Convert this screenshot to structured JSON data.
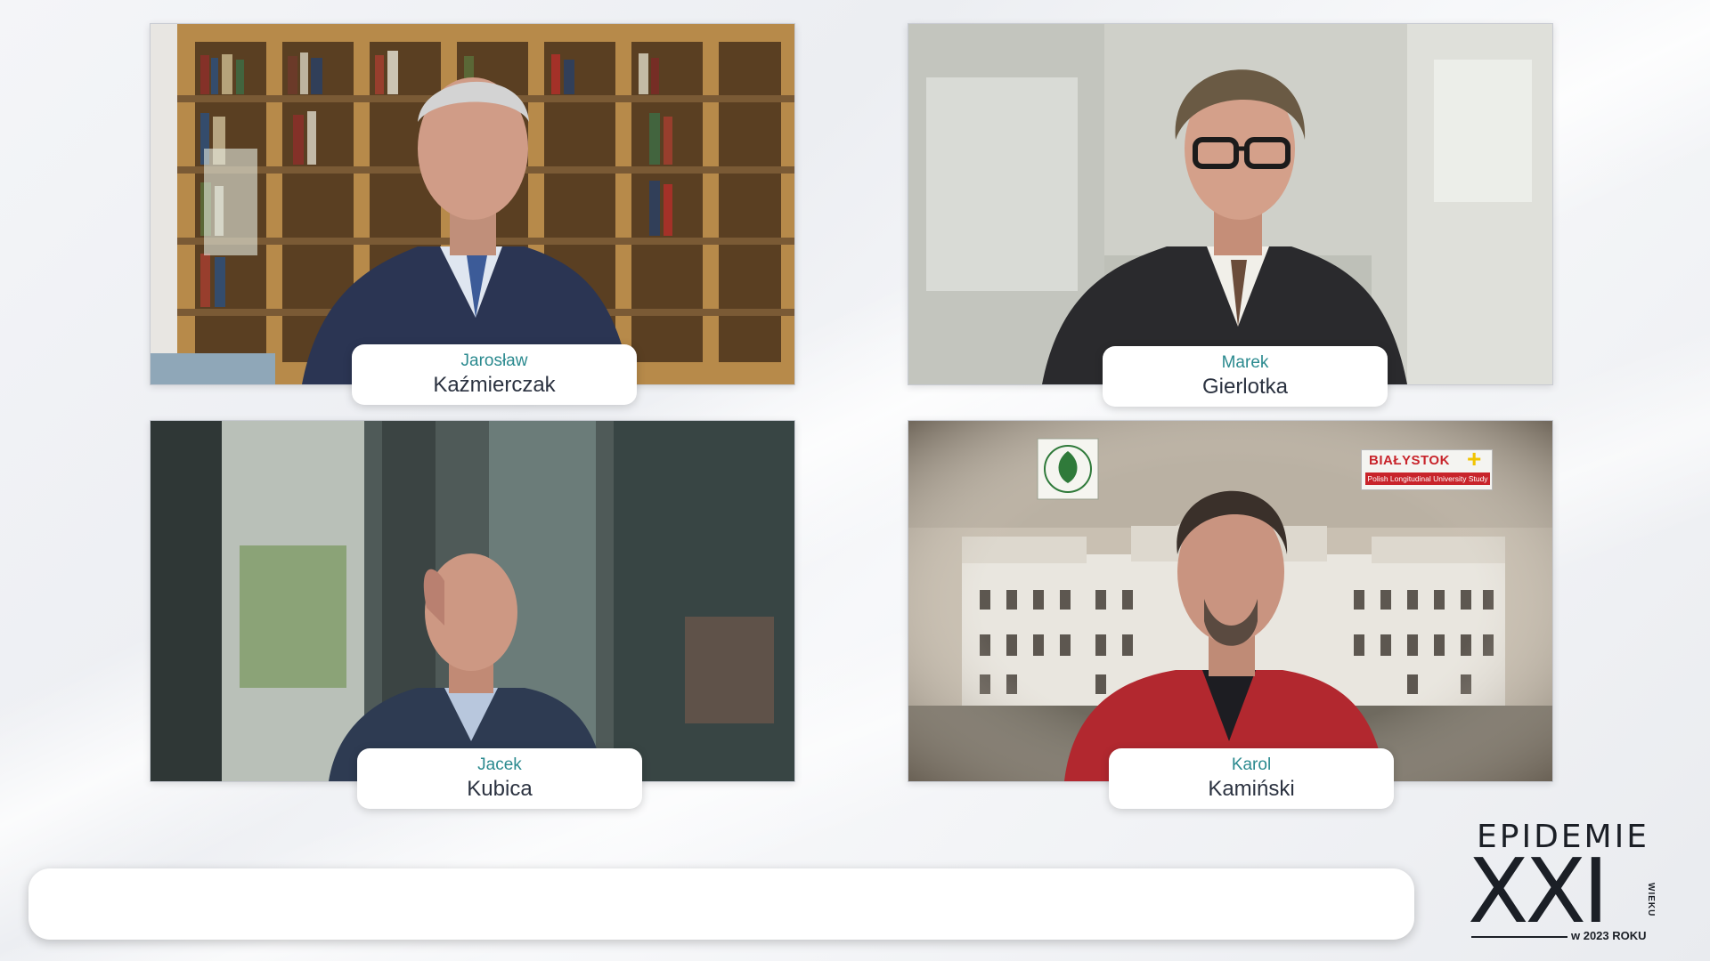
{
  "participants": [
    {
      "first": "Jarosław",
      "last": "Kaźmierczak"
    },
    {
      "first": "Marek",
      "last": "Gierlotka"
    },
    {
      "first": "Jacek",
      "last": "Kubica"
    },
    {
      "first": "Karol",
      "last": "Kamiński"
    }
  ],
  "tile4_overlay": {
    "brand": "BIAŁYSTOK",
    "plus": "+",
    "subtitle": "Polish Longitudinal University Study"
  },
  "logo": {
    "title": "EPIDEMIE",
    "numeral": "XXI",
    "side": "WIEKU",
    "year": "w 2023 ROKU"
  },
  "ticker": {
    "text": ""
  },
  "colors": {
    "accent_first_name": "#2b8a8f",
    "name_text": "#2b3240",
    "brand_red": "#c8242b",
    "logo_dark": "#1b1f26"
  }
}
